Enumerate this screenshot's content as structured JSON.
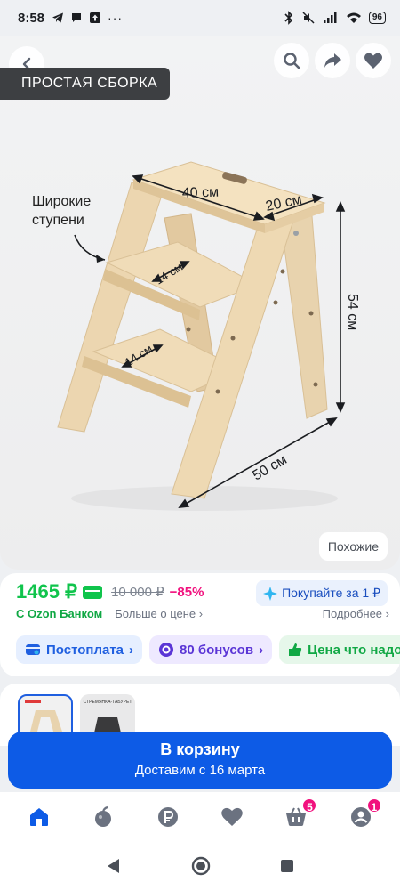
{
  "status_bar": {
    "time": "8:58",
    "battery": "96"
  },
  "hero": {
    "badge": "ПРОСТАЯ СБОРКА",
    "callout_line1": "Широкие",
    "callout_line2": "ступени",
    "dimensions": {
      "top_length": "40 см",
      "top_width": "20 см",
      "height": "54 см",
      "step1": "14 см",
      "step2": "14 см",
      "base": "50 см"
    },
    "similar_label": "Похожие"
  },
  "price": {
    "current": "1465 ₽",
    "old": "10 000 ₽",
    "discount": "−85%",
    "installment": "Покупайте за 1 ₽",
    "bank_label": "С Ozon Банком",
    "more_price": "Больше о цене",
    "details": "Подробнее"
  },
  "chips": [
    {
      "label": "Постоплата",
      "icon": "postpay-icon",
      "color": "#1f5fe0"
    },
    {
      "label": "80 бонусов",
      "icon": "bonus-icon",
      "color": "#5b36d6"
    },
    {
      "label": "Цена что надо",
      "icon": "thumbs-up-icon",
      "color": "#10a844"
    }
  ],
  "thumbnails": {
    "thumb2_caption": "СТРЕМЯНКА-ТАБУРЕТ"
  },
  "cart_button": {
    "label": "В корзину",
    "delivery": "Доставим с 16 марта"
  },
  "bottom_nav": {
    "items": [
      {
        "name": "home",
        "icon": "home-icon"
      },
      {
        "name": "fresh",
        "icon": "fresh-apple-icon"
      },
      {
        "name": "wallet",
        "icon": "ruble-icon"
      },
      {
        "name": "favorites",
        "icon": "heart-icon"
      },
      {
        "name": "cart",
        "icon": "basket-icon",
        "badge": "5"
      },
      {
        "name": "profile",
        "icon": "profile-icon",
        "badge": "1"
      }
    ]
  },
  "colors": {
    "price_green": "#10c44c",
    "discount_pink": "#f1117e",
    "primary_blue": "#0d5be6"
  }
}
